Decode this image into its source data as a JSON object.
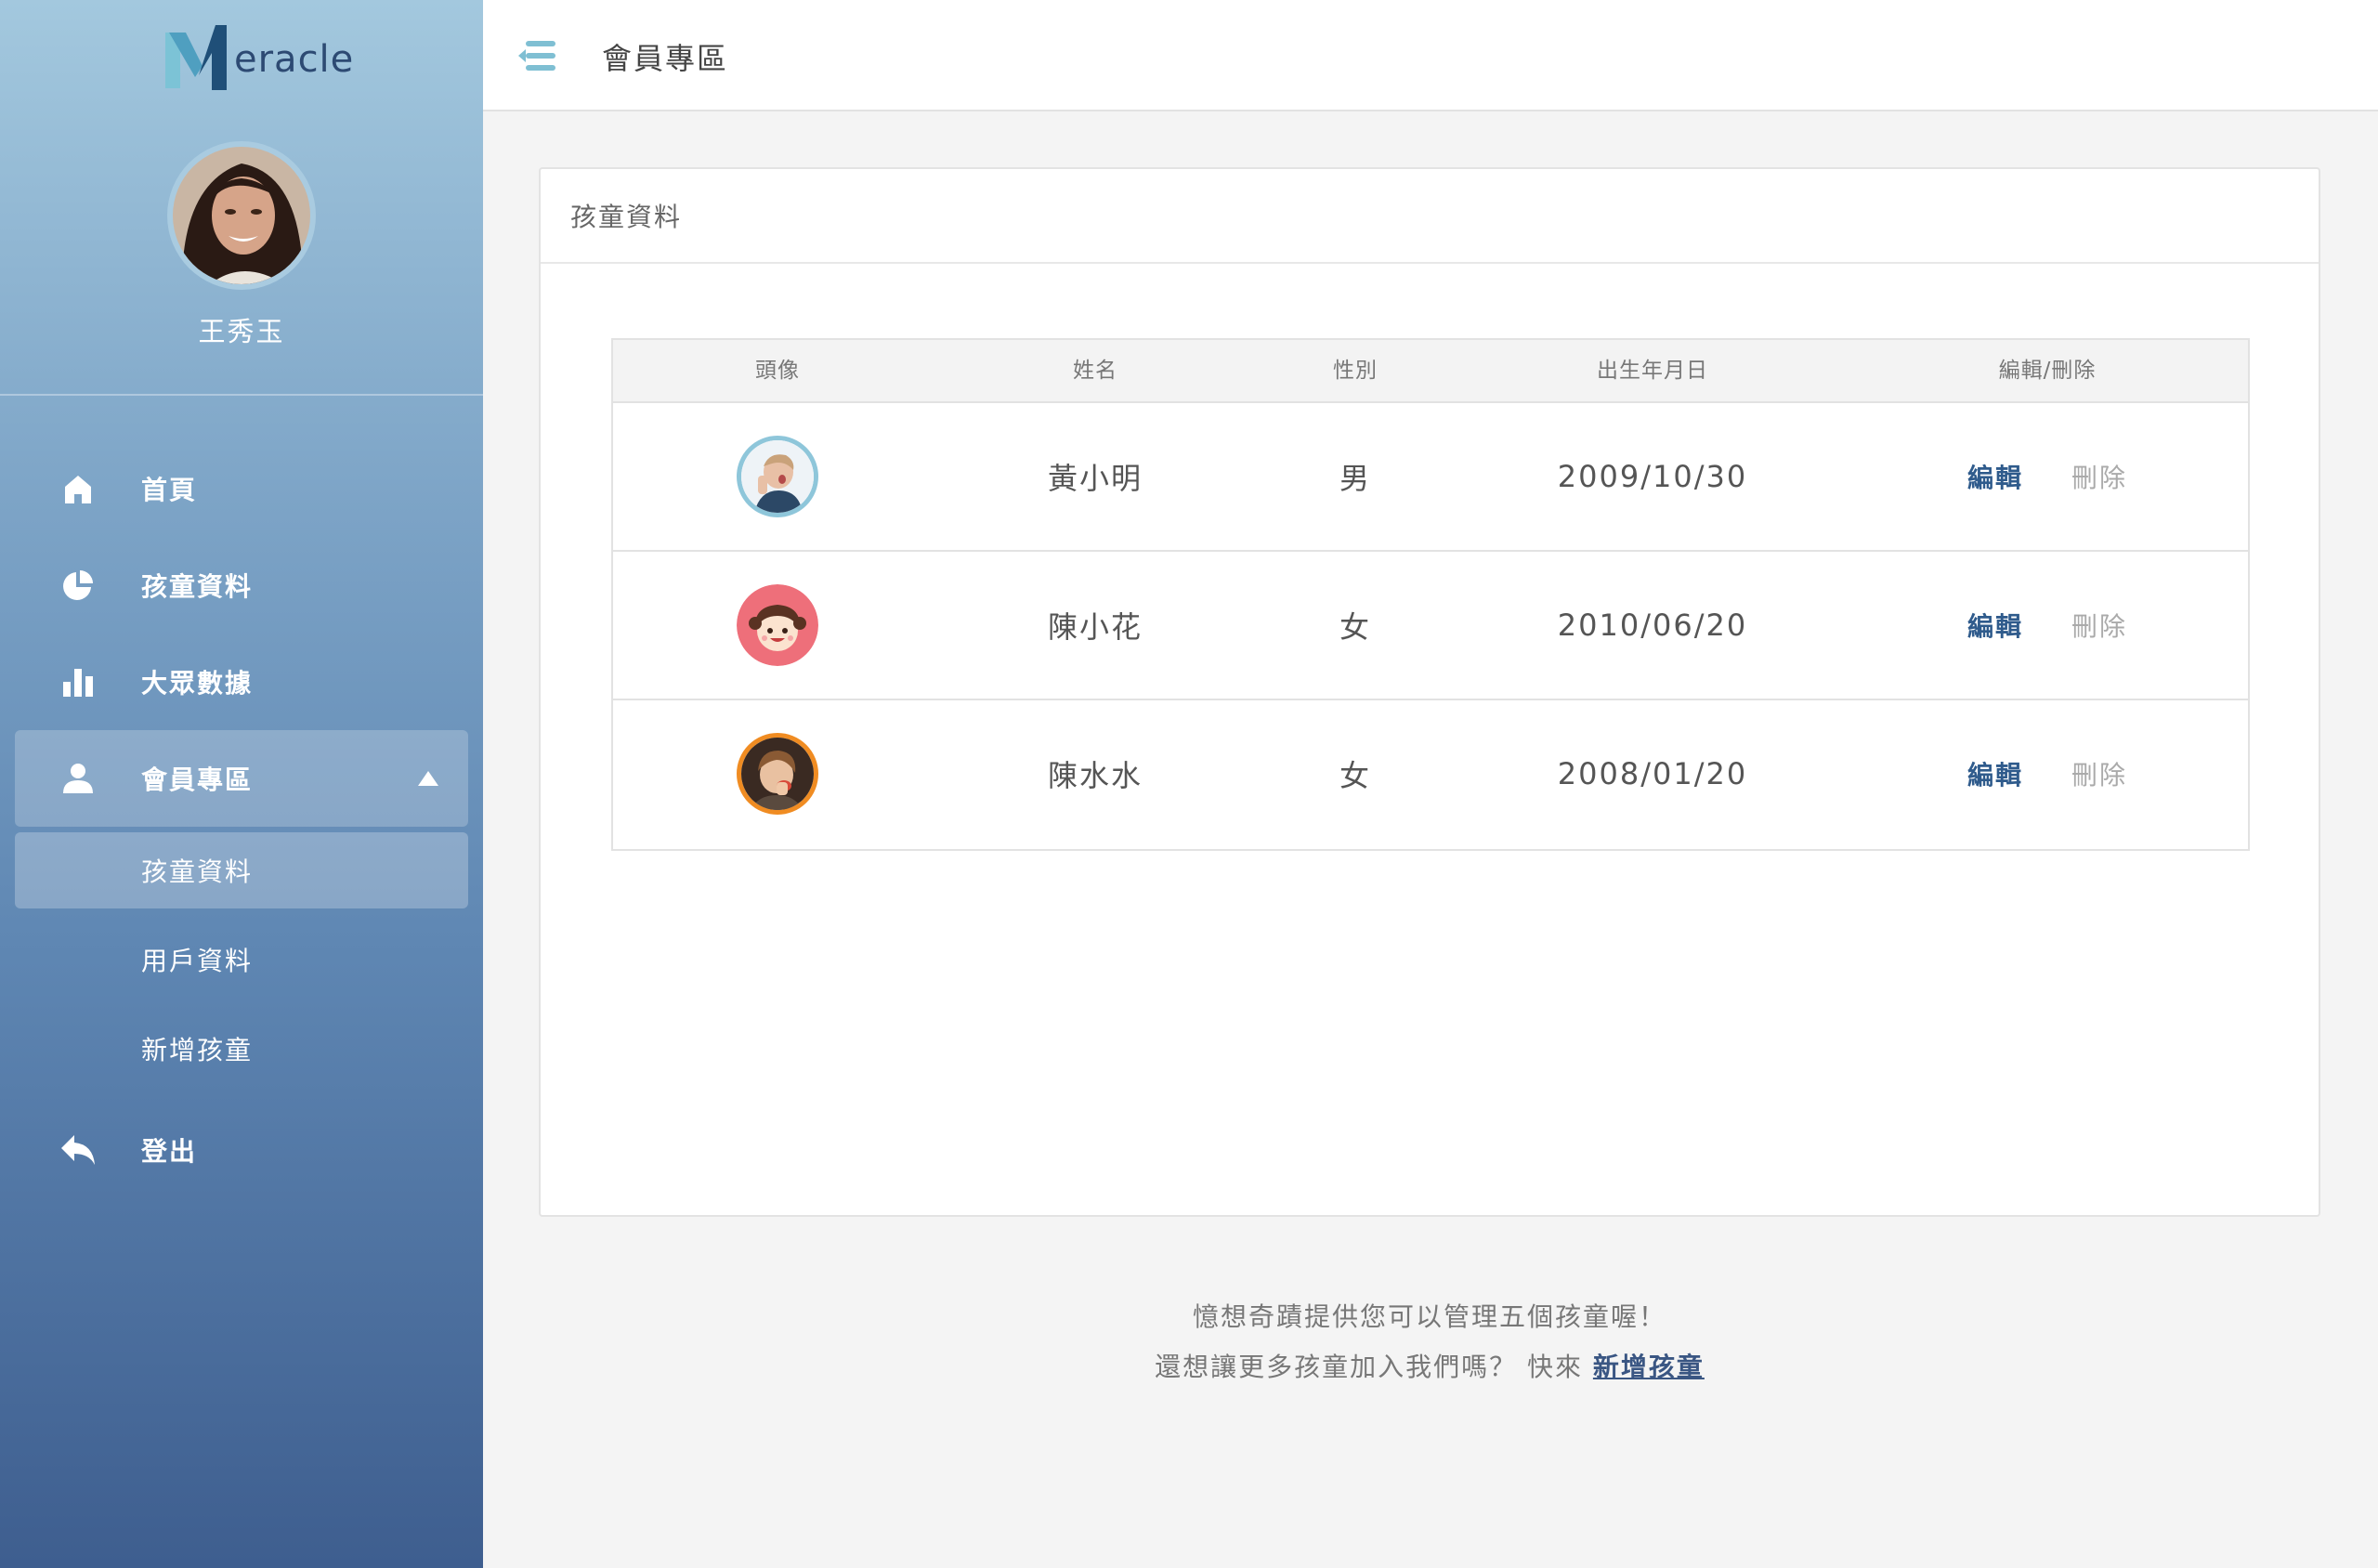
{
  "brand": {
    "logo_text": "eracle"
  },
  "user": {
    "name": "王秀玉"
  },
  "sidebar": {
    "items": [
      {
        "label": "首頁",
        "icon": "home-icon"
      },
      {
        "label": "孩童資料",
        "icon": "pie-chart-icon"
      },
      {
        "label": "大眾數據",
        "icon": "bar-chart-icon"
      },
      {
        "label": "會員專區",
        "icon": "user-icon",
        "expanded": true
      },
      {
        "label": "登出",
        "icon": "logout-arrow-icon"
      }
    ],
    "subitems": [
      {
        "label": "孩童資料",
        "active": true
      },
      {
        "label": "用戶資料"
      },
      {
        "label": "新增孩童"
      }
    ]
  },
  "header": {
    "title": "會員專區"
  },
  "card": {
    "title": "孩童資料",
    "columns": [
      "頭像",
      "姓名",
      "性別",
      "出生年月日",
      "編輯/刪除"
    ],
    "rows": [
      {
        "name": "黃小明",
        "gender": "男",
        "birthday": "2009/10/30",
        "edit": "編輯",
        "delete": "刪除",
        "avatar": "boy-photo",
        "ring": "#8ec6da"
      },
      {
        "name": "陳小花",
        "gender": "女",
        "birthday": "2010/06/20",
        "edit": "編輯",
        "delete": "刪除",
        "avatar": "girl-cartoon",
        "ring": "#ee6f7a"
      },
      {
        "name": "陳水水",
        "gender": "女",
        "birthday": "2008/01/20",
        "edit": "編輯",
        "delete": "刪除",
        "avatar": "girl-photo",
        "ring": "#f08c22"
      }
    ]
  },
  "note": {
    "line1": "憶想奇蹟提供您可以管理五個孩童喔！",
    "line2_prefix": "還想讓更多孩童加入我們嗎？ 快來 ",
    "line2_link": "新增孩童"
  },
  "colors": {
    "accent": "#2f5b8c",
    "sidebar_top": "#a3c8de",
    "sidebar_bottom": "#3e5e8f"
  }
}
